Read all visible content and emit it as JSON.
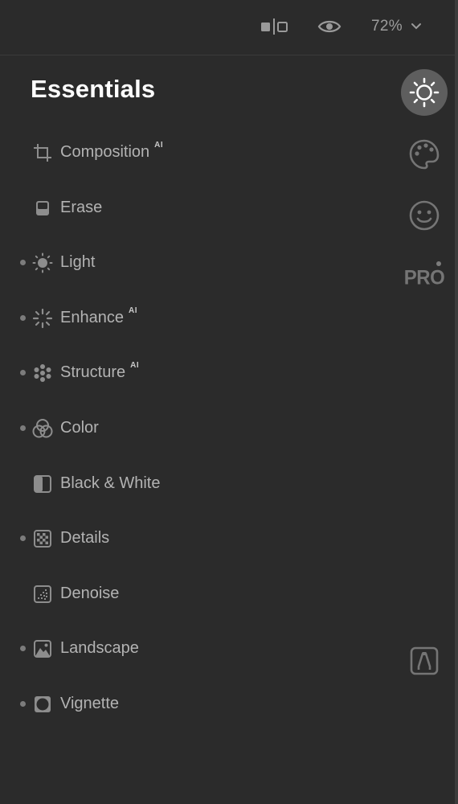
{
  "toolbar": {
    "compare_icon": "split-compare-icon",
    "preview_icon": "eye-icon",
    "zoom": "72%"
  },
  "panel": {
    "title": "Essentials",
    "ai_badge": "AI",
    "tools": [
      {
        "label": "Composition",
        "ai": true,
        "dot": false,
        "icon": "crop-icon"
      },
      {
        "label": "Erase",
        "ai": false,
        "dot": false,
        "icon": "eraser-icon"
      },
      {
        "label": "Light",
        "ai": false,
        "dot": true,
        "icon": "sun-icon"
      },
      {
        "label": "Enhance",
        "ai": true,
        "dot": true,
        "icon": "sparkle-icon"
      },
      {
        "label": "Structure",
        "ai": true,
        "dot": true,
        "icon": "dots-cluster-icon"
      },
      {
        "label": "Color",
        "ai": false,
        "dot": true,
        "icon": "color-circles-icon"
      },
      {
        "label": "Black & White",
        "ai": false,
        "dot": false,
        "icon": "half-square-icon"
      },
      {
        "label": "Details",
        "ai": false,
        "dot": true,
        "icon": "checker-icon"
      },
      {
        "label": "Denoise",
        "ai": false,
        "dot": false,
        "icon": "denoise-icon"
      },
      {
        "label": "Landscape",
        "ai": false,
        "dot": true,
        "icon": "landscape-icon"
      },
      {
        "label": "Vignette",
        "ai": false,
        "dot": true,
        "icon": "vignette-icon"
      }
    ]
  },
  "rail": {
    "pro_label": "PRO",
    "items": [
      "sun-icon",
      "palette-icon",
      "smiley-icon",
      "pro-icon",
      "presets-icon"
    ]
  },
  "colors": {
    "background": "#2b2b2b",
    "active_circle": "#5e5e5e",
    "label": "#b3b3b3",
    "title": "#ffffff"
  }
}
